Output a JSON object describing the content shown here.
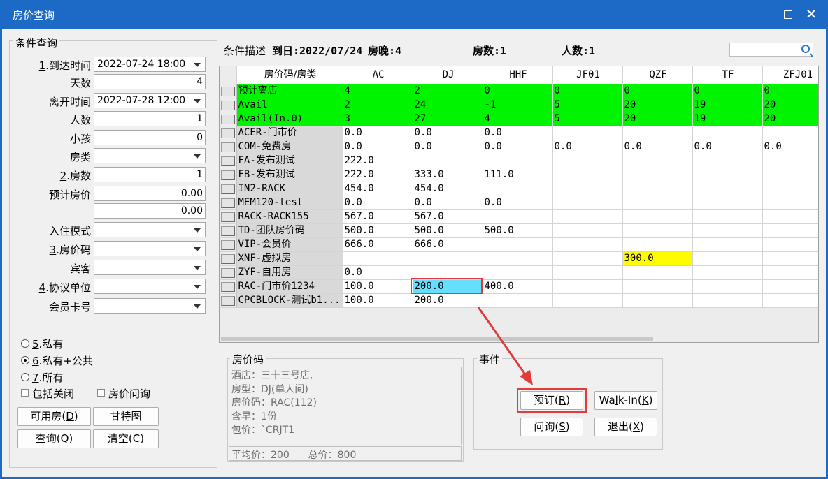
{
  "window": {
    "title": "房价查询",
    "maximize_icon": "maximize-icon",
    "close_glyph": "✕"
  },
  "left": {
    "legend": "条件查询",
    "fields": [
      {
        "name": "arrival-time-field",
        "label_prefix": "1",
        "label": ".到达时间",
        "value": "2022-07-24 18:00",
        "type": "dropdown"
      },
      {
        "name": "days-field",
        "label_prefix": "",
        "label": "天数",
        "value": "4",
        "type": "number"
      },
      {
        "name": "departure-time-field",
        "label_prefix": "",
        "label": "离开时间",
        "value": "2022-07-28 12:00",
        "type": "dropdown"
      },
      {
        "name": "adults-field",
        "label_prefix": "",
        "label": "人数",
        "value": "1",
        "type": "number"
      },
      {
        "name": "children-field",
        "label_prefix": "",
        "label": "小孩",
        "value": "0",
        "type": "number"
      },
      {
        "name": "room-type-field",
        "label_prefix": "",
        "label": "房类",
        "value": "",
        "type": "dropdown"
      },
      {
        "name": "room-count-field",
        "label_prefix": "2",
        "label": ".房数",
        "value": "1",
        "type": "number"
      },
      {
        "name": "expected-price-field",
        "label_prefix": "",
        "label": "预计房价",
        "value": "0.00",
        "type": "number"
      },
      {
        "name": "expected-price-max-field",
        "label_prefix": "",
        "label": "",
        "value": "0.00",
        "type": "number"
      },
      {
        "name": "checkin-mode-field",
        "label_prefix": "",
        "label": "入住模式",
        "value": "",
        "type": "dropdown"
      },
      {
        "name": "rate-code-field",
        "label_prefix": "3",
        "label": ".房价码",
        "value": "",
        "type": "dropdown"
      },
      {
        "name": "guest-field",
        "label_prefix": "",
        "label": "宾客",
        "value": "",
        "type": "dropdown"
      },
      {
        "name": "agreement-unit-field",
        "label_prefix": "4",
        "label": ".协议单位",
        "value": "",
        "type": "dropdown"
      },
      {
        "name": "member-card-field",
        "label_prefix": "",
        "label": "会员卡号",
        "value": "",
        "type": "dropdown"
      }
    ],
    "radios": [
      {
        "prefix": "5",
        "label": ".私有",
        "selected": false
      },
      {
        "prefix": "6",
        "label": ".私有+公共",
        "selected": true
      },
      {
        "prefix": "7",
        "label": ".所有",
        "selected": false
      }
    ],
    "checkboxes": [
      {
        "label": "包括关闭",
        "checked": false
      },
      {
        "label": "房价问询",
        "checked": false
      }
    ],
    "buttons": {
      "available": {
        "text": "可用房(",
        "key": "D",
        "end": ")"
      },
      "gantt": {
        "text": "甘特图"
      },
      "query": {
        "text": "查询(",
        "key": "Q",
        "end": ")"
      },
      "clear": {
        "text": "清空(",
        "key": "C",
        "end": ")"
      }
    }
  },
  "desc": {
    "label": "条件描述",
    "date_part": "到日:2022/07/24",
    "nights_part": "房晚:4",
    "rooms_part": "房数:1",
    "people_part": "人数:1",
    "search_icon": "search-icon"
  },
  "grid": {
    "header_label": "房价码/房类",
    "columns": [
      "AC",
      "DJ",
      "HHF",
      "JF01",
      "QZF",
      "TF",
      "ZFJ01"
    ],
    "rows": [
      {
        "label": "预计离店",
        "cells": [
          "4",
          "2",
          "0",
          "0",
          "0",
          "0",
          "0"
        ],
        "color": "green"
      },
      {
        "label": "Avail",
        "cells": [
          "2",
          "24",
          "-1",
          "5",
          "20",
          "19",
          "20"
        ],
        "color": "green"
      },
      {
        "label": "Avail(In.0)",
        "cells": [
          "3",
          "27",
          "4",
          "5",
          "20",
          "19",
          "20"
        ],
        "color": "green"
      },
      {
        "label": "ACER-门市价",
        "cells": [
          "0.0",
          "0.0",
          "0.0",
          "",
          "",
          "",
          ""
        ]
      },
      {
        "label": "COM-免费房",
        "cells": [
          "0.0",
          "0.0",
          "0.0",
          "0.0",
          "0.0",
          "0.0",
          "0.0"
        ]
      },
      {
        "label": "FA-发布测试",
        "cells": [
          "222.0",
          "",
          "",
          "",
          "",
          "",
          ""
        ]
      },
      {
        "label": "FB-发布测试",
        "cells": [
          "222.0",
          "333.0",
          "111.0",
          "",
          "",
          "",
          ""
        ]
      },
      {
        "label": "IN2-RACK",
        "cells": [
          "454.0",
          "454.0",
          "",
          "",
          "",
          "",
          ""
        ]
      },
      {
        "label": "MEM120-test",
        "cells": [
          "0.0",
          "0.0",
          "0.0",
          "",
          "",
          "",
          ""
        ]
      },
      {
        "label": "RACK-RACK155",
        "cells": [
          "567.0",
          "567.0",
          "",
          "",
          "",
          "",
          ""
        ]
      },
      {
        "label": "TD-团队房价码",
        "cells": [
          "500.0",
          "500.0",
          "500.0",
          "",
          "",
          "",
          ""
        ]
      },
      {
        "label": "VIP-会员价",
        "cells": [
          "666.0",
          "666.0",
          "",
          "",
          "",
          "",
          ""
        ]
      },
      {
        "label": "XNF-虚拟房",
        "cells": [
          "",
          "",
          "",
          "",
          "300.0",
          "",
          ""
        ],
        "highlight": {
          "col": 4,
          "color": "yellow"
        }
      },
      {
        "label": "ZYF-自用房",
        "cells": [
          "0.0",
          "",
          "",
          "",
          "",
          "",
          ""
        ]
      },
      {
        "label": "RAC-门市价1234",
        "cells": [
          "100.0",
          "200.0",
          "400.0",
          "",
          "",
          "",
          ""
        ],
        "highlight": {
          "col": 1,
          "color": "cyan"
        }
      },
      {
        "label": "CPCBLOCK-测试b1...",
        "cells": [
          "100.0",
          "200.0",
          "",
          "",
          "",
          "",
          ""
        ]
      }
    ]
  },
  "rate_info": {
    "legend": "房价码",
    "lines": [
      "酒店：三十三号店,",
      "房型：DJ(单人间)",
      "房价码：RAC(112)",
      "含早：1份",
      "包价：`CRJT1"
    ],
    "avg_label": "平均价：200",
    "total_label": "总价：800"
  },
  "events": {
    "legend": "事件",
    "book": {
      "text": "预订(",
      "key": "R",
      "end": ")"
    },
    "walkin": {
      "text": "Wa",
      "key": "l",
      "mid": "k-In(",
      "key2": "K",
      "end": ")"
    },
    "inquiry": {
      "text": "问询(",
      "key": "S",
      "end": ")"
    },
    "exit": {
      "text": "退出(",
      "key": "X",
      "end": ")"
    }
  },
  "colors": {
    "titlebar": "#1c6ac5",
    "green": "#00f400",
    "yellow": "#fffb00",
    "cyan": "#66dfff",
    "annotation_red": "#e23b3b"
  }
}
